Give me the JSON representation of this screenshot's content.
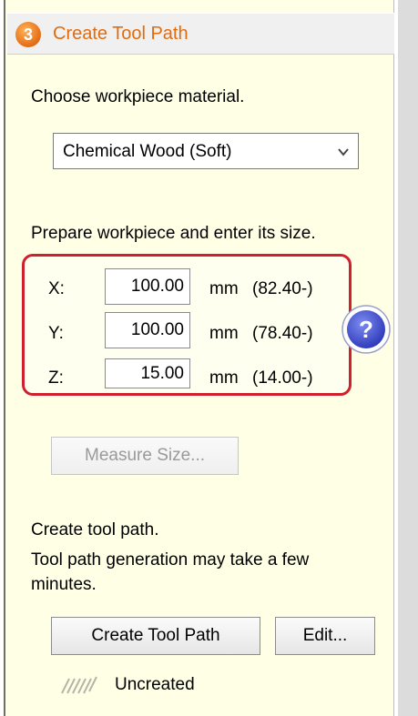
{
  "header": {
    "step": "3",
    "title": "Create Tool Path"
  },
  "material": {
    "label": "Choose workpiece material.",
    "selected": "Chemical Wood (Soft)"
  },
  "size": {
    "label": "Prepare workpiece and enter its size.",
    "rows": [
      {
        "axis": "X:",
        "value": "100.00",
        "unit": "mm",
        "range": "(82.40-)"
      },
      {
        "axis": "Y:",
        "value": "100.00",
        "unit": "mm",
        "range": "(78.40-)"
      },
      {
        "axis": "Z:",
        "value": "15.00",
        "unit": "mm",
        "range": "(14.00-)"
      }
    ],
    "help_icon": "question-icon",
    "measure_button": "Measure Size..."
  },
  "toolpath": {
    "label": "Create tool path.",
    "note_line1": "Tool path generation may take a few",
    "note_line2": "minutes.",
    "create_button": "Create Tool Path",
    "edit_button": "Edit...",
    "status": "Uncreated"
  },
  "colors": {
    "panel_bg": "#ffffe6",
    "accent_orange": "#e06c10",
    "highlight_red": "#d0202e",
    "help_blue": "#3a4fc8"
  }
}
